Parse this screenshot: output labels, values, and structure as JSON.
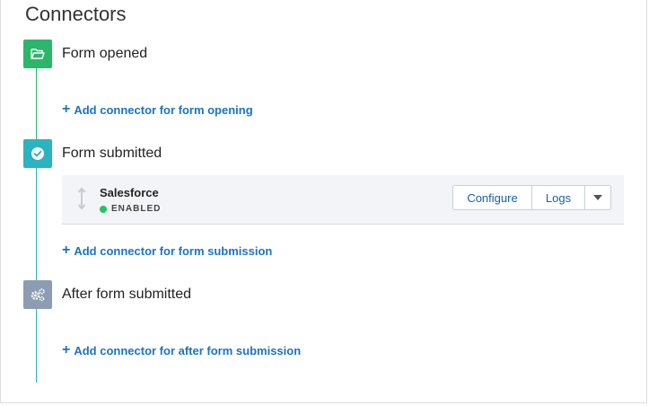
{
  "page": {
    "title": "Connectors"
  },
  "stages": [
    {
      "label": "Form opened",
      "icon": "folder-open-icon",
      "color": "#2cb66c",
      "add_link": "Add connector for form opening"
    },
    {
      "label": "Form submitted",
      "icon": "check-circle-icon",
      "color": "#2bb3c0",
      "add_link": "Add connector for form submission"
    },
    {
      "label": "After form submitted",
      "icon": "gears-icon",
      "color": "#8c9db2",
      "add_link": "Add connector for after form submission"
    }
  ],
  "connector": {
    "name": "Salesforce",
    "status": "ENABLED",
    "status_color": "#22c55e",
    "configure_label": "Configure",
    "logs_label": "Logs"
  },
  "colors": {
    "link": "#1a73c8",
    "accent_green": "#2cb66c",
    "accent_teal": "#2bb3c0"
  }
}
